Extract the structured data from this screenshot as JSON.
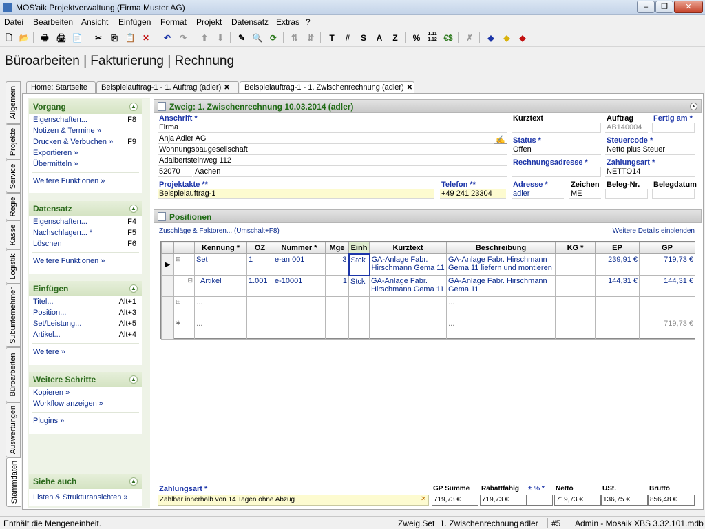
{
  "window": {
    "title": "MOS'aik Projektverwaltung (Firma Muster AG)"
  },
  "menu": [
    "Datei",
    "Bearbeiten",
    "Ansicht",
    "Einfügen",
    "Format",
    "Projekt",
    "Datensatz",
    "Extras",
    "?"
  ],
  "toolbar": {
    "t": "T",
    "hash": "#",
    "s": "S",
    "a": "A",
    "z": "Z",
    "pct": "%",
    "num": "1.11\n1.12",
    "euro": "€$"
  },
  "page_title": "Büroarbeiten | Fakturierung | Rechnung",
  "vtabs": [
    "Allgemein",
    "Projekte",
    "Service",
    "Regie",
    "Kasse",
    "Logistik",
    "Subunternehmer",
    "Büroarbeiten",
    "Auswertungen",
    "Stammdaten"
  ],
  "tabs": [
    "Home: Startseite",
    "Beispielauftrag-1 - 1. Auftrag (adler)",
    "Beispielauftrag-1 - 1. Zwischenrechnung (adler)"
  ],
  "left": {
    "vorgang": {
      "title": "Vorgang",
      "items": [
        {
          "label": "Eigenschaften...",
          "key": "F8"
        },
        {
          "label": "Notizen & Termine »",
          "key": ""
        },
        {
          "label": "Drucken & Verbuchen »",
          "key": "F9"
        },
        {
          "label": "Exportieren »",
          "key": ""
        },
        {
          "label": "Übermitteln »",
          "key": ""
        }
      ],
      "more": "Weitere Funktionen »"
    },
    "datensatz": {
      "title": "Datensatz",
      "items": [
        {
          "label": "Eigenschaften...",
          "key": "F4"
        },
        {
          "label": "Nachschlagen... *",
          "key": "F5"
        },
        {
          "label": "Löschen",
          "key": "F6"
        }
      ],
      "more": "Weitere Funktionen »"
    },
    "einfuegen": {
      "title": "Einfügen",
      "items": [
        {
          "label": "Titel...",
          "key": "Alt+1"
        },
        {
          "label": "Position...",
          "key": "Alt+3"
        },
        {
          "label": "Set/Leistung...",
          "key": "Alt+5"
        },
        {
          "label": "Artikel...",
          "key": "Alt+4"
        }
      ],
      "more": "Weitere »"
    },
    "schritte": {
      "title": "Weitere Schritte",
      "items": [
        {
          "label": "Kopieren »"
        },
        {
          "label": "Workflow anzeigen »"
        }
      ],
      "more": "Plugins »"
    },
    "siehe": {
      "title": "Siehe auch",
      "items": [
        {
          "label": "Listen & Strukturansichten »"
        }
      ]
    }
  },
  "header": {
    "title": "Zweig: 1. Zwischenrechnung 10.03.2014 (adler)",
    "anschrift_lbl": "Anschrift *",
    "anschrift": [
      "Firma",
      "Anja Adler AG",
      "Wohnungsbaugesellschaft",
      "Adalbertsteinweg 112"
    ],
    "plz": "52070",
    "ort": "Aachen",
    "kurztext_lbl": "Kurztext",
    "kurztext": "",
    "auftrag_lbl": "Auftrag",
    "auftrag": "AB140004",
    "fertig_lbl": "Fertig am *",
    "fertig": "",
    "status_lbl": "Status *",
    "status": "Offen",
    "steuercode_lbl": "Steuercode *",
    "steuercode": "Netto plus Steuer",
    "rechnungsadresse_lbl": "Rechnungsadresse *",
    "rechnungsadresse": "",
    "zahlungsart_lbl": "Zahlungsart *",
    "zahlungsart": "NETTO14",
    "projektakte_lbl": "Projektakte **",
    "projektakte": "Beispielauftrag-1",
    "telefon_lbl": "Telefon **",
    "telefon": "+49 241 23304",
    "adresse_lbl": "Adresse *",
    "adresse": "adler",
    "zeichen_lbl": "Zeichen",
    "zeichen": "ME",
    "belegnr_lbl": "Beleg-Nr.",
    "belegnr": "",
    "belegdatum_lbl": "Belegdatum",
    "belegdatum": ""
  },
  "positionen": {
    "title": "Positionen",
    "zuschlaege": "Zuschläge & Faktoren... (Umschalt+F8)",
    "details": "Weitere Details einblenden",
    "columns": [
      "Kennung *",
      "OZ",
      "Nummer *",
      "Mge",
      "Einh",
      "Kurztext",
      "Beschreibung",
      "KG *",
      "EP",
      "GP"
    ],
    "rows": [
      {
        "kennung": "Set",
        "oz": "1",
        "nummer": "e-an 001",
        "mge": "3",
        "einh": "Stck",
        "kurztext": "GA-Anlage Fabr. Hirschmann Gema 11",
        "beschreibung": "GA-Anlage Fabr. Hirschmann Gema 11 liefern und montieren",
        "kg": "",
        "ep": "239,91 €",
        "gp": "719,73 €"
      },
      {
        "kennung": "Artikel",
        "oz": "1.001",
        "nummer": "e-10001",
        "mge": "1",
        "einh": "Stck",
        "kurztext": "GA-Anlage Fabr. Hirschmann Gema 11",
        "beschreibung": "GA-Anlage Fabr. Hirschmann Gema 11",
        "kg": "",
        "ep": "144,31 €",
        "gp": "144,31 €"
      },
      {
        "kennung": "...",
        "oz": "",
        "nummer": "",
        "mge": "",
        "einh": "",
        "kurztext": "",
        "beschreibung": "...",
        "kg": "",
        "ep": "",
        "gp": ""
      },
      {
        "kennung": "...",
        "oz": "",
        "nummer": "",
        "mge": "",
        "einh": "",
        "kurztext": "",
        "beschreibung": "...",
        "kg": "",
        "ep": "",
        "gp": "719,73 €"
      }
    ]
  },
  "footer": {
    "zahlungsart_lbl": "Zahlungsart *",
    "zahlungsart": "Zahlbar innerhalb von 14 Tagen ohne Abzug",
    "gp_lbl": "GP Summe",
    "gp": "719,73 €",
    "rabatt_lbl": "Rabattfähig",
    "rabatt": "719,73 €",
    "pct_lbl": "± % *",
    "pct": "",
    "netto_lbl": "Netto",
    "netto": "719,73 €",
    "ust_lbl": "USt.",
    "ust": "136,75 €",
    "brutto_lbl": "Brutto",
    "brutto": "856,48 €"
  },
  "status": {
    "message": "Enthält die Mengeneinheit.",
    "zweig": "Zweig.Set",
    "rechnung": "1. Zwischenrechnung",
    "user": "adler",
    "nr": "#5",
    "db": "Admin - Mosaik XBS 3.32.101.mdb"
  }
}
